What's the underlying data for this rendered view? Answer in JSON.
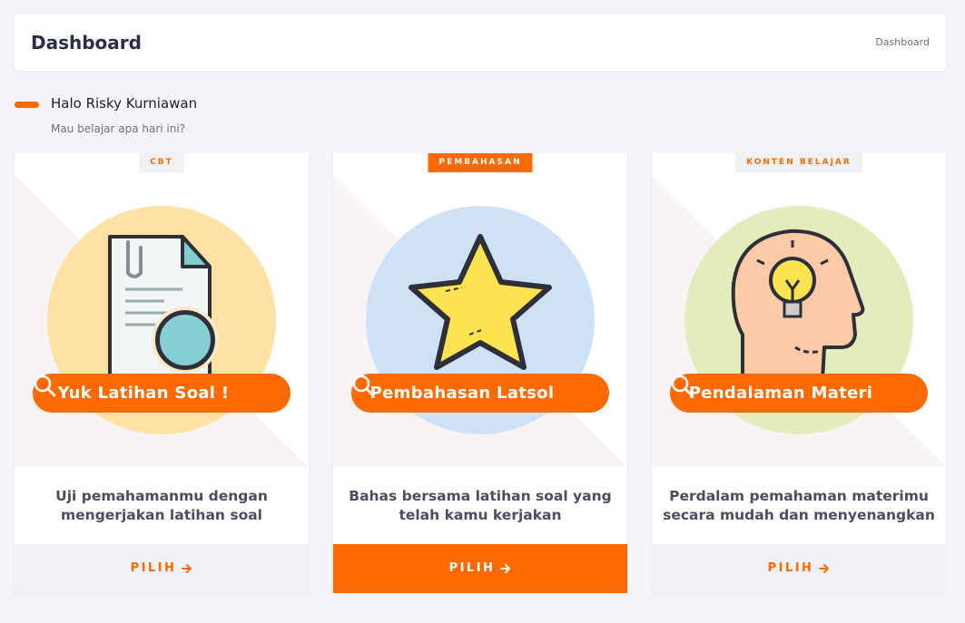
{
  "header": {
    "title": "Dashboard",
    "breadcrumb": "Dashboard"
  },
  "greeting": {
    "name": "Halo Risky Kurniawan",
    "subtitle": "Mau belajar apa hari ini?"
  },
  "colors": {
    "accent": "#ff6a00",
    "page_bg": "#f4f5f8"
  },
  "cards": [
    {
      "tag": "CBT",
      "banner": "Yuk Latihan Soal !",
      "description": "Uji pemahamanmu dengan mengerjakan latihan soal",
      "button": "PILIH",
      "illustration": "document-magnifier-icon"
    },
    {
      "tag": "PEMBAHASAN",
      "banner": "Pembahasan Latsol",
      "description": "Bahas bersama latihan soal yang telah kamu kerjakan",
      "button": "PILIH",
      "illustration": "star-icon"
    },
    {
      "tag": "KONTEN BELAJAR",
      "banner": "Pendalaman Materi",
      "description": "Perdalam pemahaman materimu secara mudah dan menyenangkan",
      "button": "PILIH",
      "illustration": "head-lightbulb-icon"
    }
  ]
}
